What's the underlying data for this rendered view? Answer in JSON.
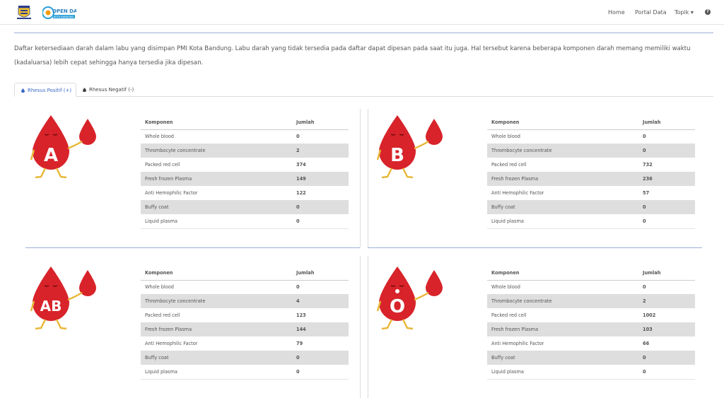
{
  "nav": {
    "items": [
      "Home",
      "Portal Data",
      "Topik ▾"
    ],
    "logo_text": "OPEN DATA",
    "logo_sub": "KOTA BANDUNG"
  },
  "description": "Daftar ketersediaan darah dalam labu yang disimpan PMI Kota Bandung. Labu darah yang tidak tersedia pada daftar dapat dipesan pada saat itu juga. Hal tersebut karena beberapa komponen darah memang memiliki waktu (kadaluarsa) lebih cepat sehingga hanya tersedia jika dipesan.",
  "tabs": [
    {
      "label": "Rhesus Positif (+)",
      "active": true
    },
    {
      "label": "Rhesus Negatif (-)",
      "active": false
    }
  ],
  "table_headers": {
    "komponen": "Komponen",
    "jumlah": "Jumlah"
  },
  "blood_groups": [
    {
      "group": "A",
      "rows": [
        {
          "komponen": "Whole blood",
          "jumlah": "0"
        },
        {
          "komponen": "Thrombocyte concentrate",
          "jumlah": "2"
        },
        {
          "komponen": "Packed red cell",
          "jumlah": "374"
        },
        {
          "komponen": "Fresh frozen Plasma",
          "jumlah": "149"
        },
        {
          "komponen": "Anti Hemophilic Factor",
          "jumlah": "122"
        },
        {
          "komponen": "Buffy coat",
          "jumlah": "0"
        },
        {
          "komponen": "Liquid plasma",
          "jumlah": "0"
        }
      ]
    },
    {
      "group": "B",
      "rows": [
        {
          "komponen": "Whole blood",
          "jumlah": "0"
        },
        {
          "komponen": "Thrombocyte concentrate",
          "jumlah": "0"
        },
        {
          "komponen": "Packed red cell",
          "jumlah": "732"
        },
        {
          "komponen": "Fresh frozen Plasma",
          "jumlah": "236"
        },
        {
          "komponen": "Anti Hemophilic Factor",
          "jumlah": "57"
        },
        {
          "komponen": "Buffy coat",
          "jumlah": "0"
        },
        {
          "komponen": "Liquid plasma",
          "jumlah": "0"
        }
      ]
    },
    {
      "group": "AB",
      "rows": [
        {
          "komponen": "Whole blood",
          "jumlah": "0"
        },
        {
          "komponen": "Thrombocyte concentrate",
          "jumlah": "4"
        },
        {
          "komponen": "Packed red cell",
          "jumlah": "123"
        },
        {
          "komponen": "Fresh frozen Plasma",
          "jumlah": "144"
        },
        {
          "komponen": "Anti Hemophilic Factor",
          "jumlah": "79"
        },
        {
          "komponen": "Buffy coat",
          "jumlah": "0"
        },
        {
          "komponen": "Liquid plasma",
          "jumlah": "0"
        }
      ]
    },
    {
      "group": "O",
      "rows": [
        {
          "komponen": "Whole blood",
          "jumlah": "0"
        },
        {
          "komponen": "Thrombocyte concentrate",
          "jumlah": "2"
        },
        {
          "komponen": "Packed red cell",
          "jumlah": "1002"
        },
        {
          "komponen": "Fresh frozen Plasma",
          "jumlah": "103"
        },
        {
          "komponen": "Anti Hemophilic Factor",
          "jumlah": "66"
        },
        {
          "komponen": "Buffy coat",
          "jumlah": "0"
        },
        {
          "komponen": "Liquid plasma",
          "jumlah": "0"
        }
      ]
    }
  ],
  "colors": {
    "blood_red": "#d8232a",
    "accent_blue": "#3a6ac8"
  },
  "icons": {
    "help": "question-circle-icon",
    "tab": "blood-drop-icon"
  }
}
